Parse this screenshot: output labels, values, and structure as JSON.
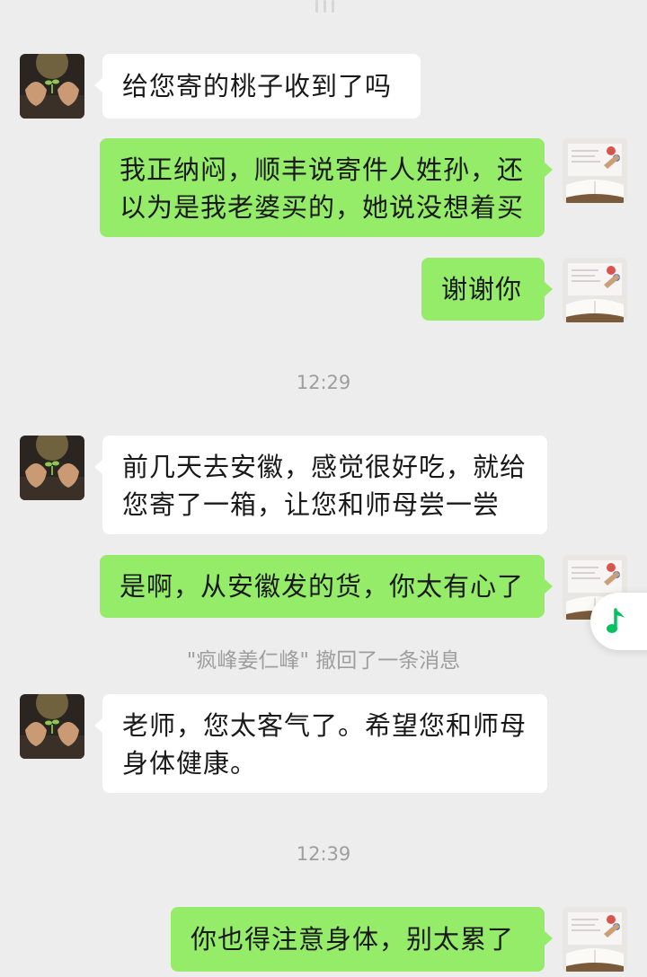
{
  "messages": [
    {
      "side": "in",
      "text": "给您寄的桃子收到了吗"
    },
    {
      "side": "out",
      "lines": [
        "我正纳闷，顺丰说寄件人姓孙，还",
        "以为是我老婆买的，她说没想着买"
      ]
    },
    {
      "side": "out",
      "text": "谢谢你"
    },
    {
      "side": "in",
      "lines": [
        "前几天去安徽，感觉很好吃，就给",
        "您寄了一箱，让您和师母尝一尝"
      ]
    },
    {
      "side": "out",
      "text": "是啊，从安徽发的货，你太有心了"
    },
    {
      "side": "in",
      "lines": [
        "老师，您太客气了。希望您和师母",
        "身体健康。"
      ]
    },
    {
      "side": "out",
      "text": "你也得注意身体，别太累了"
    }
  ],
  "timestamps": [
    "12:29",
    "12:39"
  ],
  "system_notes": [
    "\"疯峰姜仁峰\" 撤回了一条消息"
  ],
  "floating_button": {
    "icon": "music-note-icon",
    "color": "#07c160"
  },
  "colors": {
    "background": "#ededed",
    "incoming_bubble": "#ffffff",
    "outgoing_bubble": "#95ec69",
    "meta_text": "#9e9e9e"
  }
}
